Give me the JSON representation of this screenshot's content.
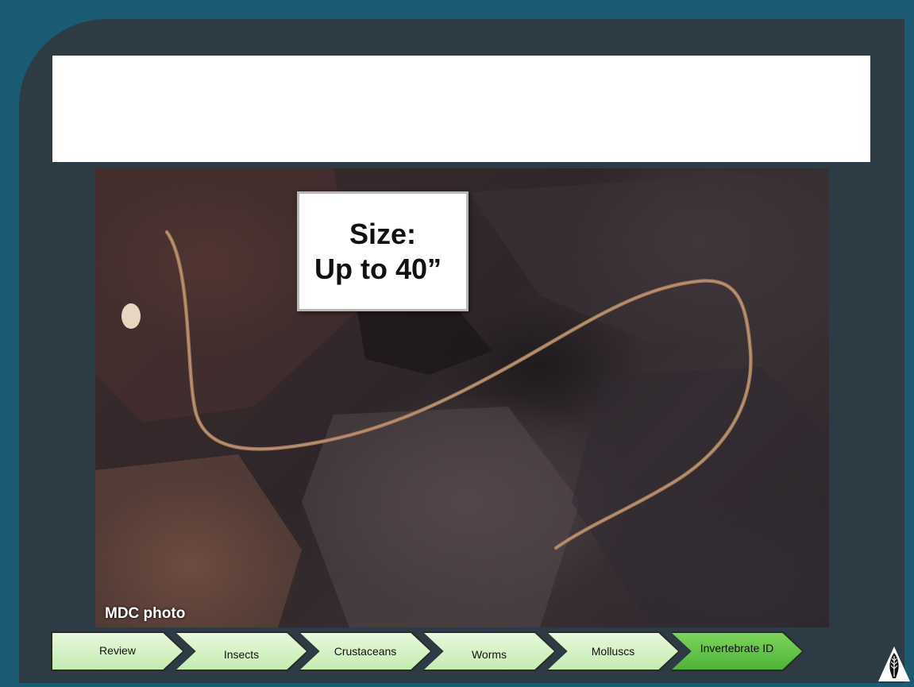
{
  "title": "",
  "photo": {
    "credit": "MDC photo"
  },
  "size_callout": {
    "line1": "Size:",
    "line2": "Up to 40”"
  },
  "nav": {
    "items": [
      {
        "label": "Review"
      },
      {
        "label": "Insects"
      },
      {
        "label": "Crustaceans"
      },
      {
        "label": "Worms"
      },
      {
        "label": "Molluscs"
      },
      {
        "label": "Invertebrate ID"
      }
    ],
    "active": "Invertebrate ID"
  },
  "icons": {
    "logo": "mdc-logo-icon"
  },
  "colors": {
    "background": "#1b5a73",
    "panel": "#2c3b44",
    "nav_button": "#c4ecb0",
    "nav_active": "#4fb33c"
  }
}
